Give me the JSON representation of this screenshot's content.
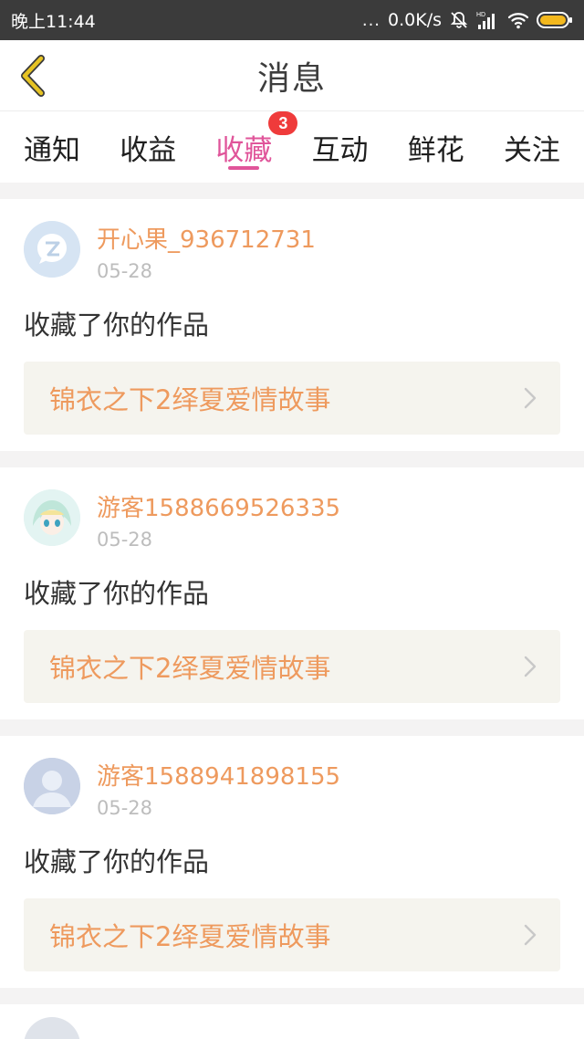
{
  "status_bar": {
    "time": "晚上11:44",
    "dots": "...",
    "speed": "0.0K/s",
    "signal_label": "HD"
  },
  "header": {
    "title": "消息",
    "back_icon": "chevron-left-icon"
  },
  "tabs": [
    {
      "label": "通知"
    },
    {
      "label": "收益"
    },
    {
      "label": "收藏",
      "badge": "3"
    },
    {
      "label": "互动"
    },
    {
      "label": "鲜花"
    },
    {
      "label": "关注"
    }
  ],
  "messages": [
    {
      "username": "开心果_936712731",
      "date": "05-28",
      "action": "收藏了你的作品",
      "work_title": "锦衣之下2绎夏爱情故事"
    },
    {
      "username": "游客1588669526335",
      "date": "05-28",
      "action": "收藏了你的作品",
      "work_title": "锦衣之下2绎夏爱情故事"
    },
    {
      "username": "游客1588941898155",
      "date": "05-28",
      "action": "收藏了你的作品",
      "work_title": "锦衣之下2绎夏爱情故事"
    }
  ],
  "colors": {
    "accent": "#e0559a",
    "username": "#ee9a5e",
    "badge": "#ef3b3b",
    "back_icon": "#e6c323"
  }
}
